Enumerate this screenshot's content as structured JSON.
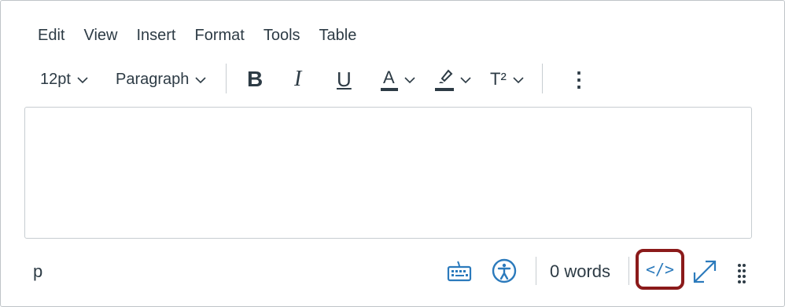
{
  "menubar": {
    "items": [
      "Edit",
      "View",
      "Insert",
      "Format",
      "Tools",
      "Table"
    ]
  },
  "toolbar": {
    "font_size": "12pt",
    "block_format": "Paragraph",
    "bold_label": "B",
    "italic_label": "I",
    "underline_label": "U",
    "font_color_label": "A",
    "superscript_label": "T²",
    "more_label": "⋮"
  },
  "statusbar": {
    "element_path": "p",
    "word_count": "0 words",
    "html_editor_label": "</>"
  },
  "colors": {
    "text": "#2d3b45",
    "accent_blue": "#2b7abc",
    "highlight_border": "#8b1a1a",
    "border": "#c7cdd1"
  }
}
